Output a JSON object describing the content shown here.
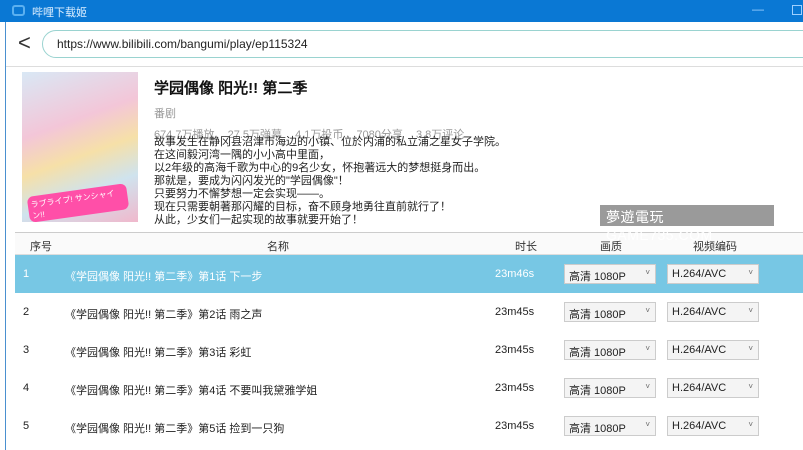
{
  "window": {
    "title": "哔哩下载姬"
  },
  "address": {
    "url": "https://www.bilibili.com/bangumi/play/ep115324"
  },
  "show": {
    "title": "学园偶像 阳光!! 第二季",
    "type": "番剧",
    "stats": [
      "674.7万播放",
      "27.5万弹幕",
      "4.1万投币",
      "7080分享",
      "3.8万评论"
    ],
    "cover_logo": "ラブライブ! サンシャイン!!",
    "description": [
      "故事发生在静冈县沼津市海边的小镇、位於内浦的私立浦之星女子学院。",
      "在这间毅河湾一隅的小小高中里面，",
      "以2年级的高海千歌为中心的9名少女，怀抱著远大的梦想挺身而出。",
      "那就是，要成为闪闪发光的\"学园偶像\"！",
      "只要努力不懈梦想一定会实现——。",
      "现在只需要朝著那闪耀的目标，奋不顾身地勇往直前就行了！",
      "从此，少女们一起实现的故事就要开始了！"
    ]
  },
  "watermark": "夢遊電玩 GAME735.COM",
  "table": {
    "headers": {
      "no": "序号",
      "name": "名称",
      "duration": "时长",
      "quality": "画质",
      "codec": "视频编码"
    },
    "rows": [
      {
        "no": "1",
        "name": "《学园偶像 阳光!! 第二季》第1话 下一步",
        "duration": "23m46s",
        "quality": "高清 1080P",
        "codec": "H.264/AVC"
      },
      {
        "no": "2",
        "name": "《学园偶像 阳光!! 第二季》第2话 雨之声",
        "duration": "23m45s",
        "quality": "高清 1080P",
        "codec": "H.264/AVC"
      },
      {
        "no": "3",
        "name": "《学园偶像 阳光!! 第二季》第3话 彩虹",
        "duration": "23m45s",
        "quality": "高清 1080P",
        "codec": "H.264/AVC"
      },
      {
        "no": "4",
        "name": "《学园偶像 阳光!! 第二季》第4话 不要叫我黛雅学姐",
        "duration": "23m45s",
        "quality": "高清 1080P",
        "codec": "H.264/AVC"
      },
      {
        "no": "5",
        "name": "《学园偶像 阳光!! 第二季》第5话 捡到一只狗",
        "duration": "23m45s",
        "quality": "高清 1080P",
        "codec": "H.264/AVC"
      }
    ]
  },
  "colors": {
    "titlebar": "#0a78d4",
    "selected_row": "#77c7e4"
  }
}
